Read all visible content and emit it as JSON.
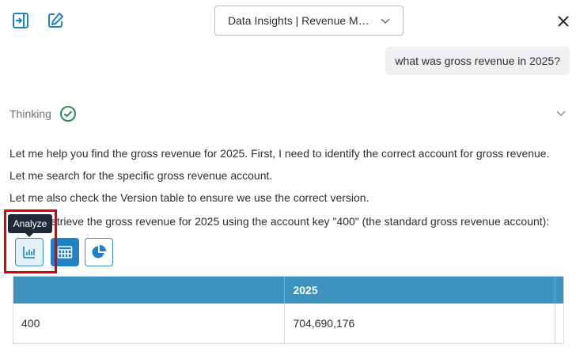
{
  "header": {
    "dataset_selector": "Data Insights | Revenue Mo...",
    "icons": {
      "expand": "sidebar-expand-icon",
      "new_chat": "edit-icon",
      "close": "close-icon"
    }
  },
  "chat": {
    "user_message": "what was gross revenue in 2025?",
    "thinking": {
      "label": "Thinking",
      "status_icon": "check-circle-icon",
      "status_color": "#2e8b57"
    },
    "assistant_lines": [
      "Let me help you find the gross revenue for 2025. First, I need to identify the correct account for gross revenue.",
      "Let me search for the specific gross revenue account.",
      "Let me also check the Version table to ensure we use the correct version.",
      "etrieve the gross revenue for 2025 using the account key \"400\" (the standard gross revenue account):"
    ],
    "tooltip": "Analyze",
    "view_buttons": [
      {
        "name": "analyze",
        "icon": "bar-chart-icon"
      },
      {
        "name": "table",
        "icon": "table-icon"
      },
      {
        "name": "pie",
        "icon": "pie-chart-icon"
      }
    ]
  },
  "result_table": {
    "headers": [
      "",
      "2025"
    ],
    "rows": [
      [
        "400",
        "704,690,176"
      ]
    ]
  },
  "colors": {
    "accent": "#1f82c5",
    "table_header": "#3d93bd",
    "highlight": "#e00000"
  }
}
